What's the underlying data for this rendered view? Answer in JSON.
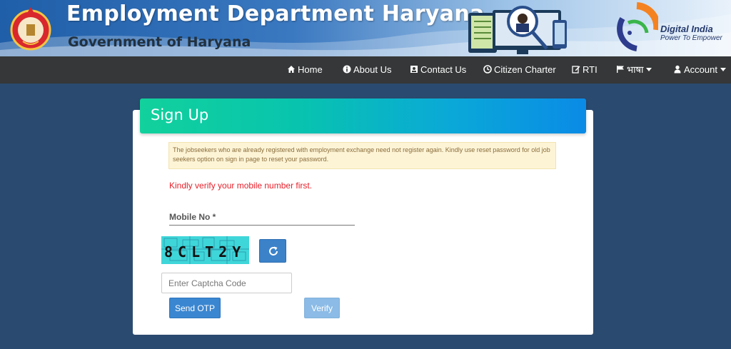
{
  "header": {
    "title": "Employment Department Haryana",
    "subtitle": "Government of Haryana",
    "digital_india_title": "Digital India",
    "digital_india_tagline": "Power To Empower",
    "emblem_icon": "haryana-emblem",
    "colors": {
      "banner_start": "#1f5ea8",
      "banner_end": "#e9f2fb"
    }
  },
  "nav": {
    "items": [
      {
        "label": "Home",
        "icon": "home-icon"
      },
      {
        "label": "About Us",
        "icon": "info-circle-icon"
      },
      {
        "label": "Contact Us",
        "icon": "contact-card-icon"
      },
      {
        "label": "Citizen Charter",
        "icon": "clock-icon"
      },
      {
        "label": "RTI",
        "icon": "edit-icon"
      },
      {
        "label": "भाषा",
        "icon": "flag-icon",
        "dropdown": true
      },
      {
        "label": "Account",
        "icon": "user-icon",
        "dropdown": true
      }
    ]
  },
  "signup": {
    "heading": "Sign Up",
    "notice": "The jobseekers who are already registered with employment exchange need not register again. Kindly use reset password for old job seekers option on sign in page to reset your password.",
    "warning": "Kindly verify your mobile number first.",
    "mobile_label": "Mobile No *",
    "captcha_text": "8CLT2Y",
    "captcha_placeholder": "Enter Captcha Code",
    "send_otp_label": "Send OTP",
    "verify_label": "Verify",
    "colors": {
      "heading_start": "#12d19c",
      "heading_end": "#0a8be6",
      "warning": "#e6202a",
      "button": "#3a86d1"
    }
  }
}
